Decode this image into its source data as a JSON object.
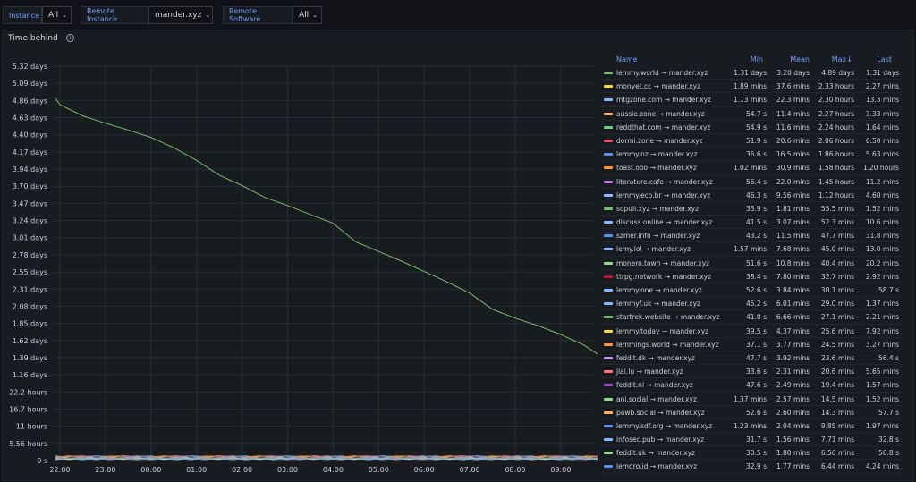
{
  "toolbar": {
    "instance_label": "Instance",
    "instance_value": "All",
    "remote_instance_label": "Remote Instance",
    "remote_instance_value": "mander.xyz",
    "remote_software_label": "Remote Software",
    "remote_software_value": "All"
  },
  "panel": {
    "title": "Time behind"
  },
  "chart_data": {
    "type": "line",
    "y_ticks": [
      "5.32 days",
      "5.09 days",
      "4.86 days",
      "4.63 days",
      "4.40 days",
      "4.17 days",
      "3.94 days",
      "3.70 days",
      "3.47 days",
      "3.24 days",
      "3.01 days",
      "2.78 days",
      "2.55 days",
      "2.31 days",
      "2.08 days",
      "1.85 days",
      "1.62 days",
      "1.39 days",
      "1.16 days",
      "22.2 hours",
      "16.7 hours",
      "11 hours",
      "5.56 hours",
      "0 s"
    ],
    "x_ticks": [
      "22:00",
      "23:00",
      "00:00",
      "01:00",
      "02:00",
      "03:00",
      "04:00",
      "05:00",
      "06:00",
      "07:00",
      "08:00",
      "09:00"
    ],
    "series": [
      {
        "name": "lemmy.world → mander.xyz",
        "color": "#73bf69",
        "points": [
          [
            -0.1,
            4.89
          ],
          [
            0,
            4.8
          ],
          [
            0.5,
            4.65
          ],
          [
            1,
            4.55
          ],
          [
            1.5,
            4.46
          ],
          [
            2,
            4.36
          ],
          [
            2.5,
            4.22
          ],
          [
            3,
            4.05
          ],
          [
            3.5,
            3.85
          ],
          [
            4,
            3.71
          ],
          [
            4.5,
            3.55
          ],
          [
            5,
            3.44
          ],
          [
            5.5,
            3.32
          ],
          [
            6,
            3.2
          ],
          [
            6.5,
            2.95
          ],
          [
            7,
            2.82
          ],
          [
            7.5,
            2.69
          ],
          [
            8,
            2.55
          ],
          [
            8.5,
            2.41
          ],
          [
            9,
            2.26
          ],
          [
            9.5,
            2.04
          ],
          [
            10,
            1.92
          ],
          [
            10.5,
            1.82
          ],
          [
            11,
            1.7
          ],
          [
            11.5,
            1.56
          ],
          [
            11.85,
            1.42
          ]
        ]
      }
    ],
    "ylim": [
      0,
      5.32
    ],
    "legend_columns": [
      "Name",
      "Min",
      "Mean",
      "Max",
      "Last"
    ],
    "legend_max_sort": "↓",
    "legend": [
      {
        "name": "lemmy.world → mander.xyz",
        "min": "1.31 days",
        "mean": "3.20 days",
        "max": "4.89 days",
        "last": "1.31 days",
        "color": "#73bf69"
      },
      {
        "name": "monyet.cc → mander.xyz",
        "min": "1.89 mins",
        "mean": "37.6 mins",
        "max": "2.33 hours",
        "last": "2.27 mins",
        "color": "#fade2a"
      },
      {
        "name": "mtgzone.com → mander.xyz",
        "min": "1.13 mins",
        "mean": "22.3 mins",
        "max": "2.30 hours",
        "last": "13.3 mins",
        "color": "#8ab8ff"
      },
      {
        "name": "aussie.zone → mander.xyz",
        "min": "54.7 s",
        "mean": "11.4 mins",
        "max": "2.27 hours",
        "last": "3.33 mins",
        "color": "#ffb357"
      },
      {
        "name": "reddthat.com → mander.xyz",
        "min": "54.9 s",
        "mean": "11.6 mins",
        "max": "2.24 hours",
        "last": "1.64 mins",
        "color": "#6ccf8e"
      },
      {
        "name": "dormi.zone → mander.xyz",
        "min": "51.9 s",
        "mean": "20.6 mins",
        "max": "2.06 hours",
        "last": "6.50 mins",
        "color": "#f2495c"
      },
      {
        "name": "lemmy.nz → mander.xyz",
        "min": "36.6 s",
        "mean": "16.5 mins",
        "max": "1.86 hours",
        "last": "5.63 mins",
        "color": "#5794f2"
      },
      {
        "name": "toast.ooo → mander.xyz",
        "min": "1.02 mins",
        "mean": "30.9 mins",
        "max": "1.58 hours",
        "last": "1.20 hours",
        "color": "#ff9830"
      },
      {
        "name": "literature.cafe → mander.xyz",
        "min": "56.4 s",
        "mean": "22.0 mins",
        "max": "1.45 hours",
        "last": "11.2 mins",
        "color": "#b877d9"
      },
      {
        "name": "lemmy.eco.br → mander.xyz",
        "min": "46.3 s",
        "mean": "9.56 mins",
        "max": "1.12 hours",
        "last": "4.60 mins",
        "color": "#8ab8ff"
      },
      {
        "name": "sopuli.xyz → mander.xyz",
        "min": "33.9 s",
        "mean": "1.81 mins",
        "max": "55.5 mins",
        "last": "1.52 mins",
        "color": "#73bf69"
      },
      {
        "name": "discuss.online → mander.xyz",
        "min": "41.5 s",
        "mean": "3.07 mins",
        "max": "52.3 mins",
        "last": "10.6 mins",
        "color": "#8ab8ff"
      },
      {
        "name": "szmer.info → mander.xyz",
        "min": "43.2 s",
        "mean": "11.5 mins",
        "max": "47.7 mins",
        "last": "31.8 mins",
        "color": "#5794f2"
      },
      {
        "name": "lemy.lol → mander.xyz",
        "min": "1.57 mins",
        "mean": "7.68 mins",
        "max": "45.0 mins",
        "last": "13.0 mins",
        "color": "#8ab8ff"
      },
      {
        "name": "monero.town → mander.xyz",
        "min": "51.6 s",
        "mean": "10.8 mins",
        "max": "40.4 mins",
        "last": "20.2 mins",
        "color": "#96d98d"
      },
      {
        "name": "ttrpg.network → mander.xyz",
        "min": "38.4 s",
        "mean": "7.80 mins",
        "max": "32.7 mins",
        "last": "2.92 mins",
        "color": "#c4162a"
      },
      {
        "name": "lemmy.one → mander.xyz",
        "min": "52.6 s",
        "mean": "3.84 mins",
        "max": "30.1 mins",
        "last": "58.7 s",
        "color": "#8ab8ff"
      },
      {
        "name": "lemmyf.uk → mander.xyz",
        "min": "45.2 s",
        "mean": "6.01 mins",
        "max": "29.0 mins",
        "last": "1.37 mins",
        "color": "#8ab8ff"
      },
      {
        "name": "startrek.website → mander.xyz",
        "min": "41.0 s",
        "mean": "6.66 mins",
        "max": "27.1 mins",
        "last": "2.21 mins",
        "color": "#73bf69"
      },
      {
        "name": "lemmy.today → mander.xyz",
        "min": "39.5 s",
        "mean": "4.37 mins",
        "max": "25.6 mins",
        "last": "7.92 mins",
        "color": "#fade2a"
      },
      {
        "name": "lemmings.world → mander.xyz",
        "min": "37.1 s",
        "mean": "3.77 mins",
        "max": "24.5 mins",
        "last": "3.27 mins",
        "color": "#ff9830"
      },
      {
        "name": "feddit.dk → mander.xyz",
        "min": "47.7 s",
        "mean": "3.92 mins",
        "max": "23.6 mins",
        "last": "56.4 s",
        "color": "#ca95e5"
      },
      {
        "name": "jlai.lu → mander.xyz",
        "min": "33.6 s",
        "mean": "2.31 mins",
        "max": "20.6 mins",
        "last": "5.65 mins",
        "color": "#ff7383"
      },
      {
        "name": "feddit.nl → mander.xyz",
        "min": "47.6 s",
        "mean": "2.49 mins",
        "max": "19.4 mins",
        "last": "1.57 mins",
        "color": "#a352cc"
      },
      {
        "name": "ani.social → mander.xyz",
        "min": "1.37 mins",
        "mean": "2.57 mins",
        "max": "14.5 mins",
        "last": "1.52 mins",
        "color": "#96d98d"
      },
      {
        "name": "pawb.social → mander.xyz",
        "min": "52.6 s",
        "mean": "2.60 mins",
        "max": "14.3 mins",
        "last": "57.7 s",
        "color": "#ffb357"
      },
      {
        "name": "lemmy.sdf.org → mander.xyz",
        "min": "1.23 mins",
        "mean": "2.04 mins",
        "max": "9.85 mins",
        "last": "1.97 mins",
        "color": "#5794f2"
      },
      {
        "name": "infosec.pub → mander.xyz",
        "min": "31.7 s",
        "mean": "1.56 mins",
        "max": "7.71 mins",
        "last": "32.8 s",
        "color": "#8ab8ff"
      },
      {
        "name": "feddit.uk → mander.xyz",
        "min": "30.5 s",
        "mean": "1.80 mins",
        "max": "6.56 mins",
        "last": "56.8 s",
        "color": "#96d98d"
      },
      {
        "name": "lemdro.id → mander.xyz",
        "min": "32.9 s",
        "mean": "1.77 mins",
        "max": "6.44 mins",
        "last": "4.24 mins",
        "color": "#5794f2"
      }
    ]
  }
}
